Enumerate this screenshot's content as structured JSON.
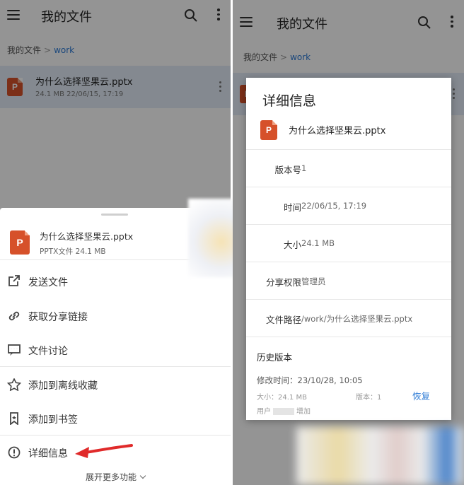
{
  "app": {
    "title": "我的文件"
  },
  "breadcrumb": {
    "root": "我的文件",
    "separator": ">",
    "current": "work"
  },
  "file": {
    "name": "为什么选择坚果云.pptx",
    "meta": "24.1 MB 22/06/15, 17:19",
    "icon_letter": "P"
  },
  "sheet": {
    "file_name": "为什么选择坚果云.pptx",
    "file_meta": "PPTX文件 24.1 MB",
    "actions": [
      {
        "label": "发送文件",
        "icon": "share-out-icon"
      },
      {
        "label": "获取分享链接",
        "icon": "link-icon"
      },
      {
        "label": "文件讨论",
        "icon": "chat-icon"
      },
      {
        "label": "添加到离线收藏",
        "icon": "star-icon"
      },
      {
        "label": "添加到书签",
        "icon": "bookmark-icon"
      },
      {
        "label": "详细信息",
        "icon": "info-icon"
      }
    ],
    "more_label": "展开更多功能"
  },
  "details": {
    "title": "详细信息",
    "file_name": "为什么选择坚果云.pptx",
    "rows": [
      {
        "key": "版本号",
        "value": "1"
      },
      {
        "key": "时间",
        "value": "22/06/15, 17:19"
      },
      {
        "key": "大小",
        "value": "24.1 MB"
      },
      {
        "key": "分享权限",
        "value": "管理员"
      },
      {
        "key": "文件路径",
        "value": "/work/为什么选择坚果云.pptx"
      }
    ],
    "history": {
      "title": "历史版本",
      "modified": "修改时间：23/10/28, 10:05",
      "size": "大小：24.1 MB",
      "version": "版本：1",
      "restore": "恢复",
      "user_prefix": "用户",
      "user_suffix": "增加"
    }
  },
  "colors": {
    "accent": "#2d7bd6",
    "ppt": "#d6512a",
    "highlight_row": "#e3edf8",
    "arrow": "#e02a2a"
  }
}
